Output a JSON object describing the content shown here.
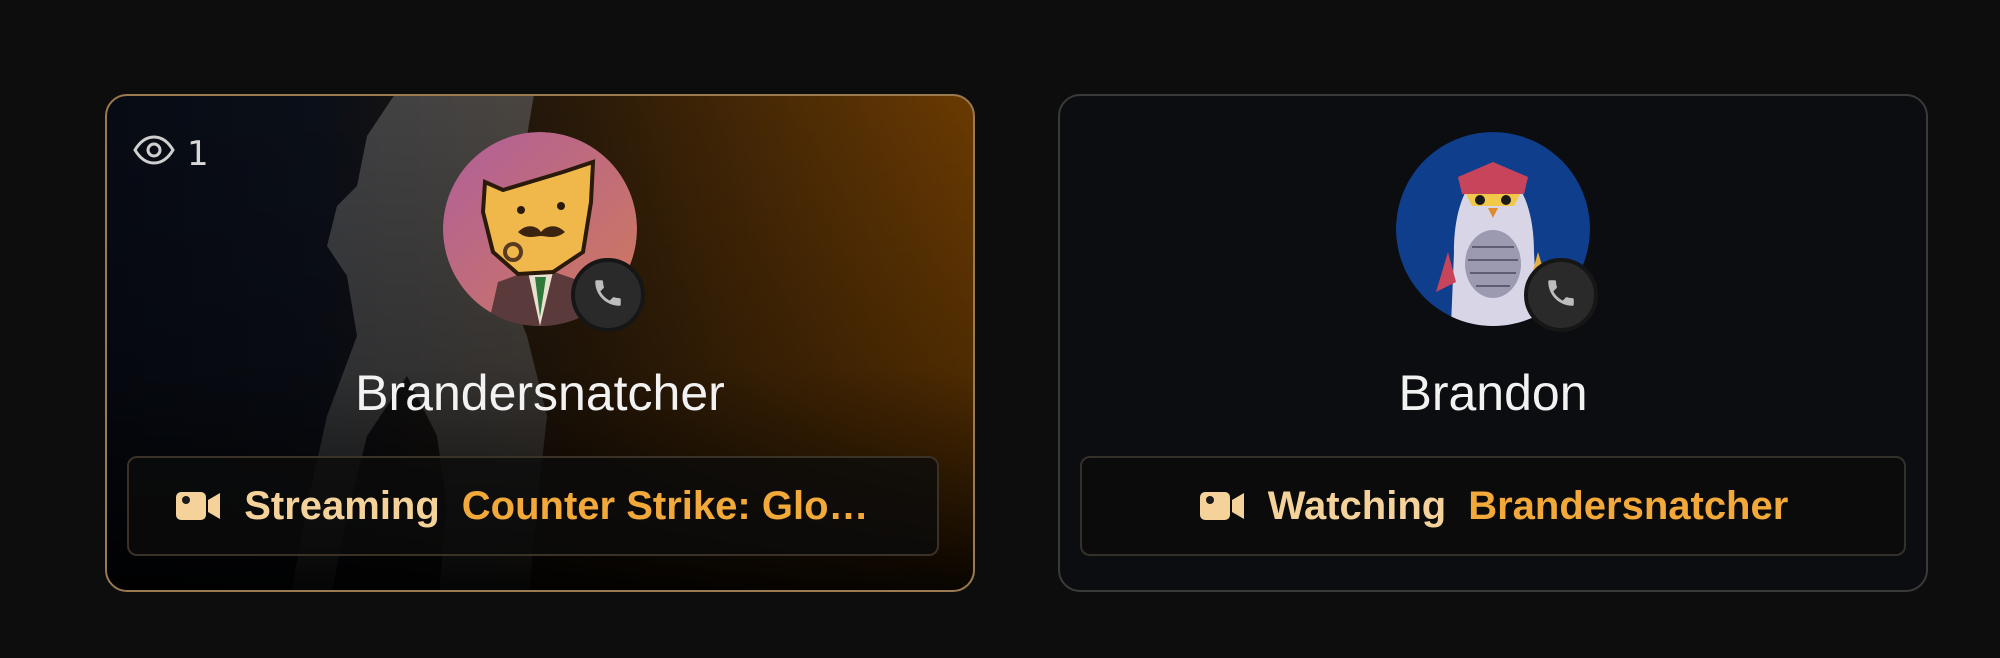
{
  "colors": {
    "background": "#0d0d0d",
    "accent_orange": "#f2a93a",
    "verb_cream": "#f4d29a",
    "card_1_border": "#9a7a4e",
    "card_2_border": "#3a3a3a"
  },
  "cards": [
    {
      "viewer_icon": "eye-icon",
      "viewer_count": "1",
      "name": "Brandersnatcher",
      "avatar": "cartoon-fox-with-mustache-avatar",
      "call_icon": "phone-icon",
      "activity": {
        "icon": "video-camera-icon",
        "verb": "Streaming",
        "target": "Counter Strike: Global Offensive"
      }
    },
    {
      "name": "Brandon",
      "avatar": "cartoon-owl-avatar",
      "call_icon": "phone-icon",
      "activity": {
        "icon": "video-camera-icon",
        "verb": "Watching",
        "target": "Brandersnatcher"
      }
    }
  ]
}
